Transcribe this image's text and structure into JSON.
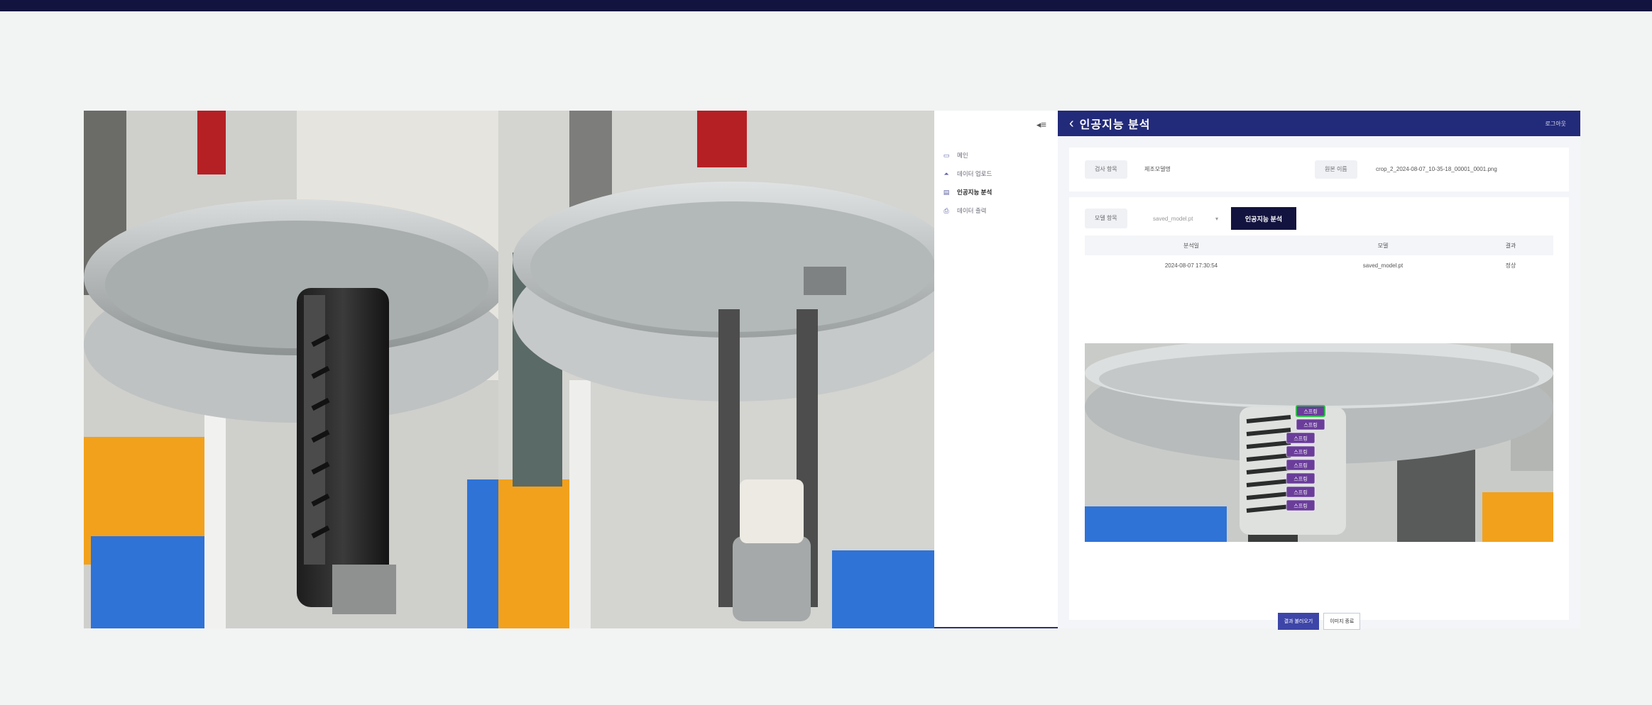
{
  "sidebar": {
    "collapse_icon": "collapse-left-icon",
    "items": [
      {
        "label": "메인",
        "icon": "monitor-icon",
        "active": false
      },
      {
        "label": "데이터 업로드",
        "icon": "upload-icon",
        "active": false
      },
      {
        "label": "인공지능 분석",
        "icon": "analysis-icon",
        "active": true
      },
      {
        "label": "데이터 출력",
        "icon": "print-icon",
        "active": false
      }
    ]
  },
  "header": {
    "back_icon": "chevron-left-icon",
    "title": "인공지능 분석",
    "user_link": "로그아웃"
  },
  "info": {
    "label1": "검사 항목",
    "value1": "제조모델명",
    "label2": "원본 이름",
    "value2": "crop_2_2024-08-07_10-35-18_00001_0001.png"
  },
  "analysis": {
    "model_label": "모델 항목",
    "model_selected": "saved_model.pt",
    "analyze_button": "인공지능 분석",
    "table": {
      "headers": [
        "분석일",
        "모델",
        "결과"
      ],
      "rows": [
        [
          "2024-08-07 17:30:54",
          "saved_model.pt",
          "정상"
        ]
      ]
    },
    "detection_label": "스프링",
    "buttons": {
      "primary": "결과 불러오기",
      "secondary": "이미지 종료"
    }
  },
  "colors": {
    "header_bg": "#222a7a",
    "analyze_button_bg": "#13133f",
    "detection_box": "#6a3d9a",
    "detection_highlight": "#2fbf4a"
  }
}
